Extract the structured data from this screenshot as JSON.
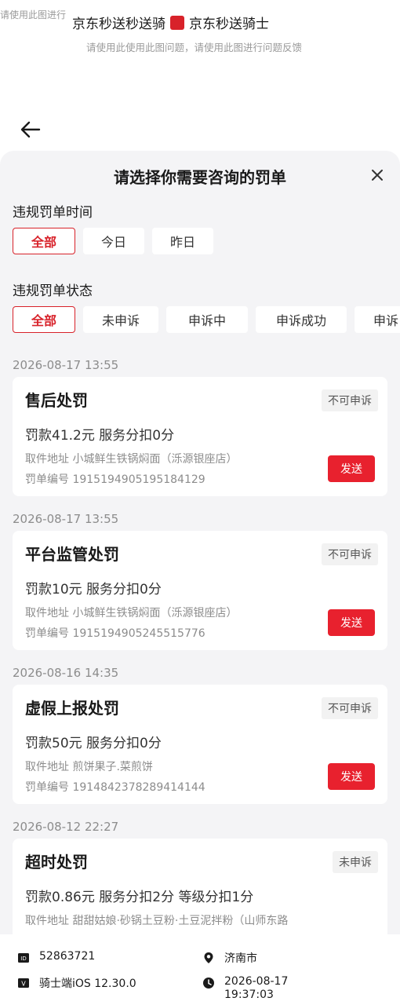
{
  "top": {
    "watermark_text": "请使用此图进行",
    "title_left": "京东秒送秒送骑",
    "title_right": "京东秒送骑士",
    "subtitle": "请使用此使用此图问题，请使用此图进行问题反馈"
  },
  "sheet": {
    "title": "请选择你需要咨询的罚单",
    "time_filter": {
      "label": "违规罚单时间",
      "options": [
        "全部",
        "今日",
        "昨日"
      ],
      "selected_index": 0
    },
    "status_filter": {
      "label": "违规罚单状态",
      "options": [
        "全部",
        "未申诉",
        "申诉中",
        "申诉成功",
        "申诉"
      ],
      "selected_index": 0
    },
    "tickets": [
      {
        "date": "2026-08-17 13:55",
        "title": "售后处罚",
        "status": "不可申诉",
        "fine": "罚款41.2元  服务分扣0分",
        "address": "取件地址  小城鲜生铁锅焖面（泺源银座店）",
        "number": "罚单编号  1915194905195184129",
        "send_label": "发送"
      },
      {
        "date": "2026-08-17 13:55",
        "title": "平台监管处罚",
        "status": "不可申诉",
        "fine": "罚款10元  服务分扣0分",
        "address": "取件地址  小城鲜生铁锅焖面（泺源银座店）",
        "number": "罚单编号  1915194905245515776",
        "send_label": "发送"
      },
      {
        "date": "2026-08-16 14:35",
        "title": "虚假上报处罚",
        "status": "不可申诉",
        "fine": "罚款50元  服务分扣0分",
        "address": "取件地址  煎饼果子.菜煎饼",
        "number": "罚单编号  1914842378289414144",
        "send_label": "发送"
      },
      {
        "date": "2026-08-12 22:27",
        "title": "超时处罚",
        "status": "未申诉",
        "fine": "罚款0.86元  服务分扣2分  等级分扣1分",
        "address": "取件地址  甜甜姑娘·砂锅土豆粉·土豆泥拌粉（山师东路",
        "number": "",
        "send_label": ""
      }
    ]
  },
  "info": {
    "id": "52863721",
    "city": "济南市",
    "client": "骑士端iOS  12.30.0",
    "datetime_date": "2026-08-17",
    "datetime_time": "19:37:03"
  },
  "colors": {
    "accent": "#d8222a",
    "send_button": "#e8212e",
    "sheet_bg": "#f4f4f6"
  }
}
